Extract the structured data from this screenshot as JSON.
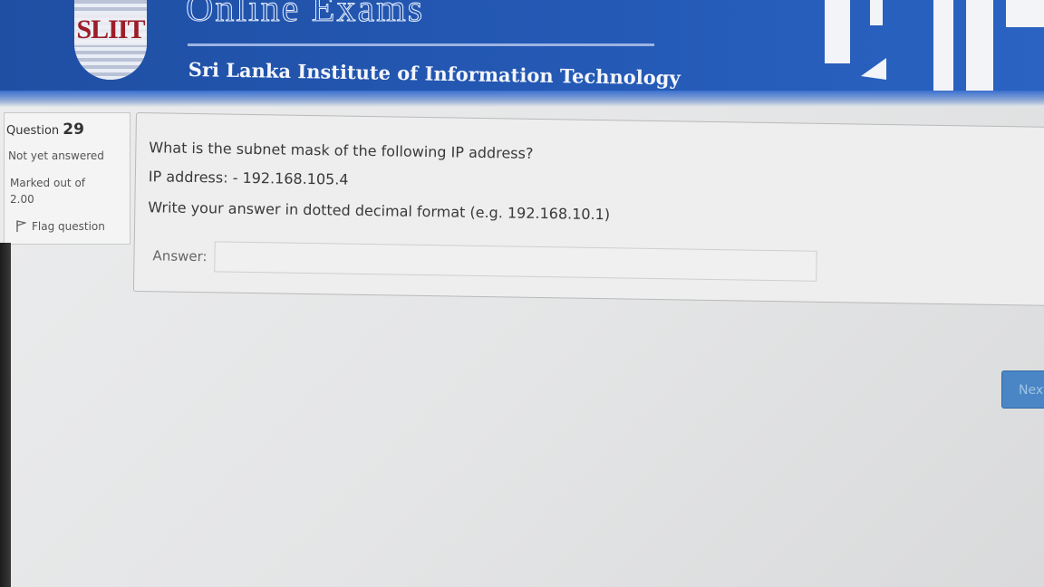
{
  "header": {
    "logo_text": "SLIIT",
    "title": "Online Exams",
    "subtitle": "Sri Lanka Institute of Information Technology",
    "colors": {
      "banner": "#2459b5",
      "logo_text": "#9c1d2a"
    }
  },
  "question_info": {
    "question_label": "Question",
    "question_number": "29",
    "state": "Not yet answered",
    "marked_label": "Marked out of",
    "marked_value": "2.00",
    "flag_label": "Flag question",
    "flag_icon": "flag-icon"
  },
  "question": {
    "line1": "What is the subnet mask of the following IP address?",
    "line2": "IP address: - 192.168.105.4",
    "line3": "Write your answer in dotted decimal format (e.g. 192.168.10.1)",
    "answer_label": "Answer:",
    "answer_value": ""
  },
  "navigation": {
    "next_label": "Next",
    "button_color": "#4a86c5"
  }
}
